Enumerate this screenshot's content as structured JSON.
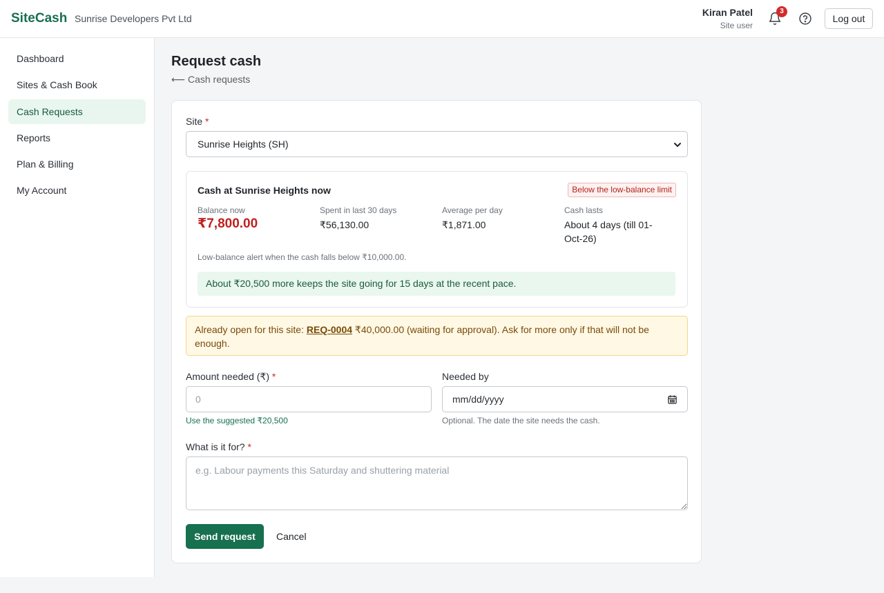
{
  "header": {
    "brand": "SiteCash",
    "org": "Sunrise Developers Pvt Ltd",
    "user_name": "Kiran Patel",
    "user_role": "Site user",
    "notification_count": "3",
    "logout_label": "Log out",
    "icons": [
      "bell-icon",
      "help-icon"
    ]
  },
  "sidebar": {
    "items": [
      {
        "label": "Dashboard",
        "active": false
      },
      {
        "label": "Sites & Cash Book",
        "active": false
      },
      {
        "label": "Cash Requests",
        "active": true
      },
      {
        "label": "Reports",
        "active": false
      },
      {
        "label": "Plan & Billing",
        "active": false
      },
      {
        "label": "My Account",
        "active": false
      }
    ]
  },
  "page": {
    "title": "Request cash",
    "back_label": "⟵ Cash requests"
  },
  "form": {
    "site_label": "Site",
    "site_value": "Sunrise Heights (SH)",
    "required_mark": "*",
    "cash": {
      "title": "Cash at Sunrise Heights now",
      "tag": "Below the low-balance limit",
      "balance_label": "Balance now",
      "balance_value": "₹7,800.00",
      "spent_label": "Spent in last 30 days",
      "spent_value": "₹56,130.00",
      "avg_label": "Average per day",
      "avg_value": "₹1,871.00",
      "lasts_label": "Cash lasts",
      "lasts_value": "About 4 days (till 01-Oct-26)",
      "alert_note": "Low-balance alert when the cash falls below ₹10,000.00.",
      "suggest_note": "About ₹20,500 more keeps the site going for 15 days at the recent pace."
    },
    "warning": {
      "prefix": "Already open for this site: ",
      "req_id": "REQ-0004",
      "suffix": " ₹40,000.00 (waiting for approval). Ask for more only if that will not be enough."
    },
    "amount_label": "Amount needed (₹)",
    "amount_placeholder": "0",
    "amount_suggest": "Use the suggested ₹20,500",
    "needed_by_label": "Needed by",
    "needed_by_placeholder": "mm/dd/yyyy",
    "needed_by_hint": "Optional. The date the site needs the cash.",
    "purpose_label": "What is it for?",
    "purpose_placeholder": "e.g. Labour payments this Saturday and shuttering material",
    "send_label": "Send request",
    "cancel_label": "Cancel"
  },
  "colors": {
    "brand": "#17704f",
    "danger": "#c01f1f",
    "warning_bg": "#fff8e5",
    "success_bg": "#e9f7ee"
  }
}
